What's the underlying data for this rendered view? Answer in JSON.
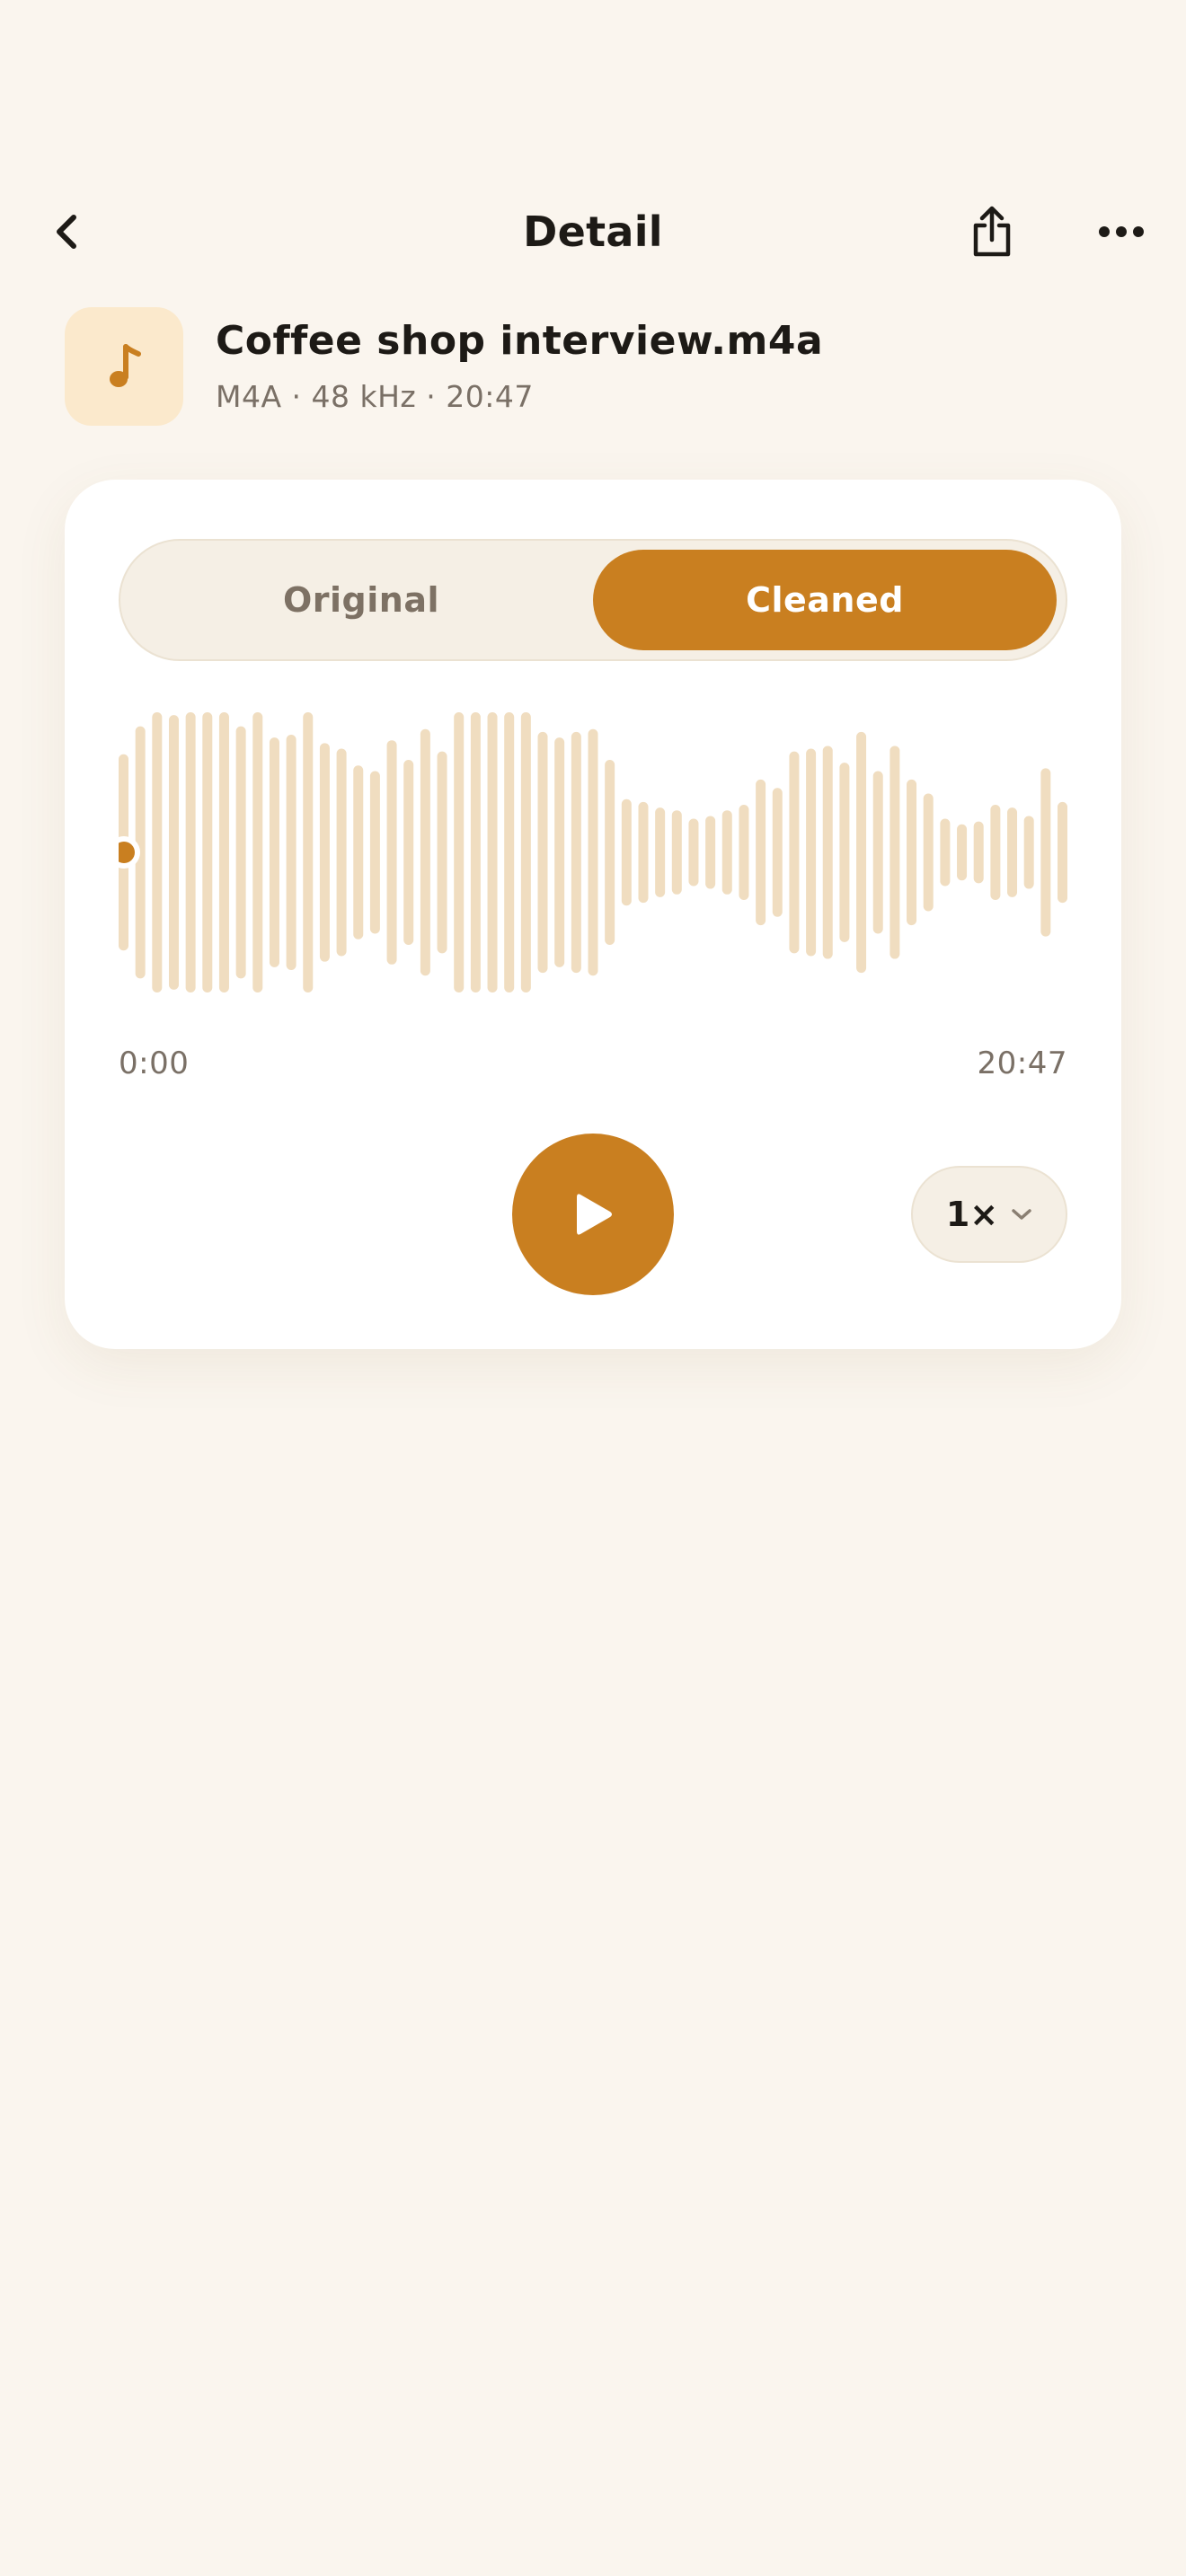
{
  "nav": {
    "title": "Detail",
    "back_icon": "chevron-left-icon",
    "share_icon": "share-icon",
    "more_icon": "more-horizontal-icon"
  },
  "file": {
    "name": "Coffee shop interview.m4a",
    "meta": "M4A · 48 kHz · 20:47",
    "icon": "music-note-icon"
  },
  "player": {
    "segments": [
      {
        "label": "Original",
        "selected": false
      },
      {
        "label": "Cleaned",
        "selected": true
      }
    ],
    "time_start": "0:00",
    "time_end": "20:47",
    "progress": 0,
    "play_icon": "play-icon",
    "speed_label": "1×",
    "speed_icon": "chevron-down-icon",
    "waveform_amplitudes": [
      0.7,
      0.9,
      1.0,
      0.98,
      1.0,
      1.0,
      1.0,
      0.9,
      1.0,
      0.82,
      0.84,
      1.0,
      0.78,
      0.74,
      0.62,
      0.58,
      0.8,
      0.66,
      0.88,
      0.72,
      1.0,
      1.0,
      1.0,
      1.0,
      1.0,
      0.86,
      0.82,
      0.86,
      0.88,
      0.66,
      0.38,
      0.36,
      0.32,
      0.3,
      0.24,
      0.26,
      0.3,
      0.34,
      0.52,
      0.46,
      0.72,
      0.74,
      0.76,
      0.64,
      0.86,
      0.58,
      0.76,
      0.52,
      0.42,
      0.24,
      0.2,
      0.22,
      0.34,
      0.32,
      0.26,
      0.6,
      0.36
    ],
    "colors": {
      "accent": "#c97f20",
      "waveform": "#f0ddc0",
      "background": "#faf5ee"
    }
  }
}
